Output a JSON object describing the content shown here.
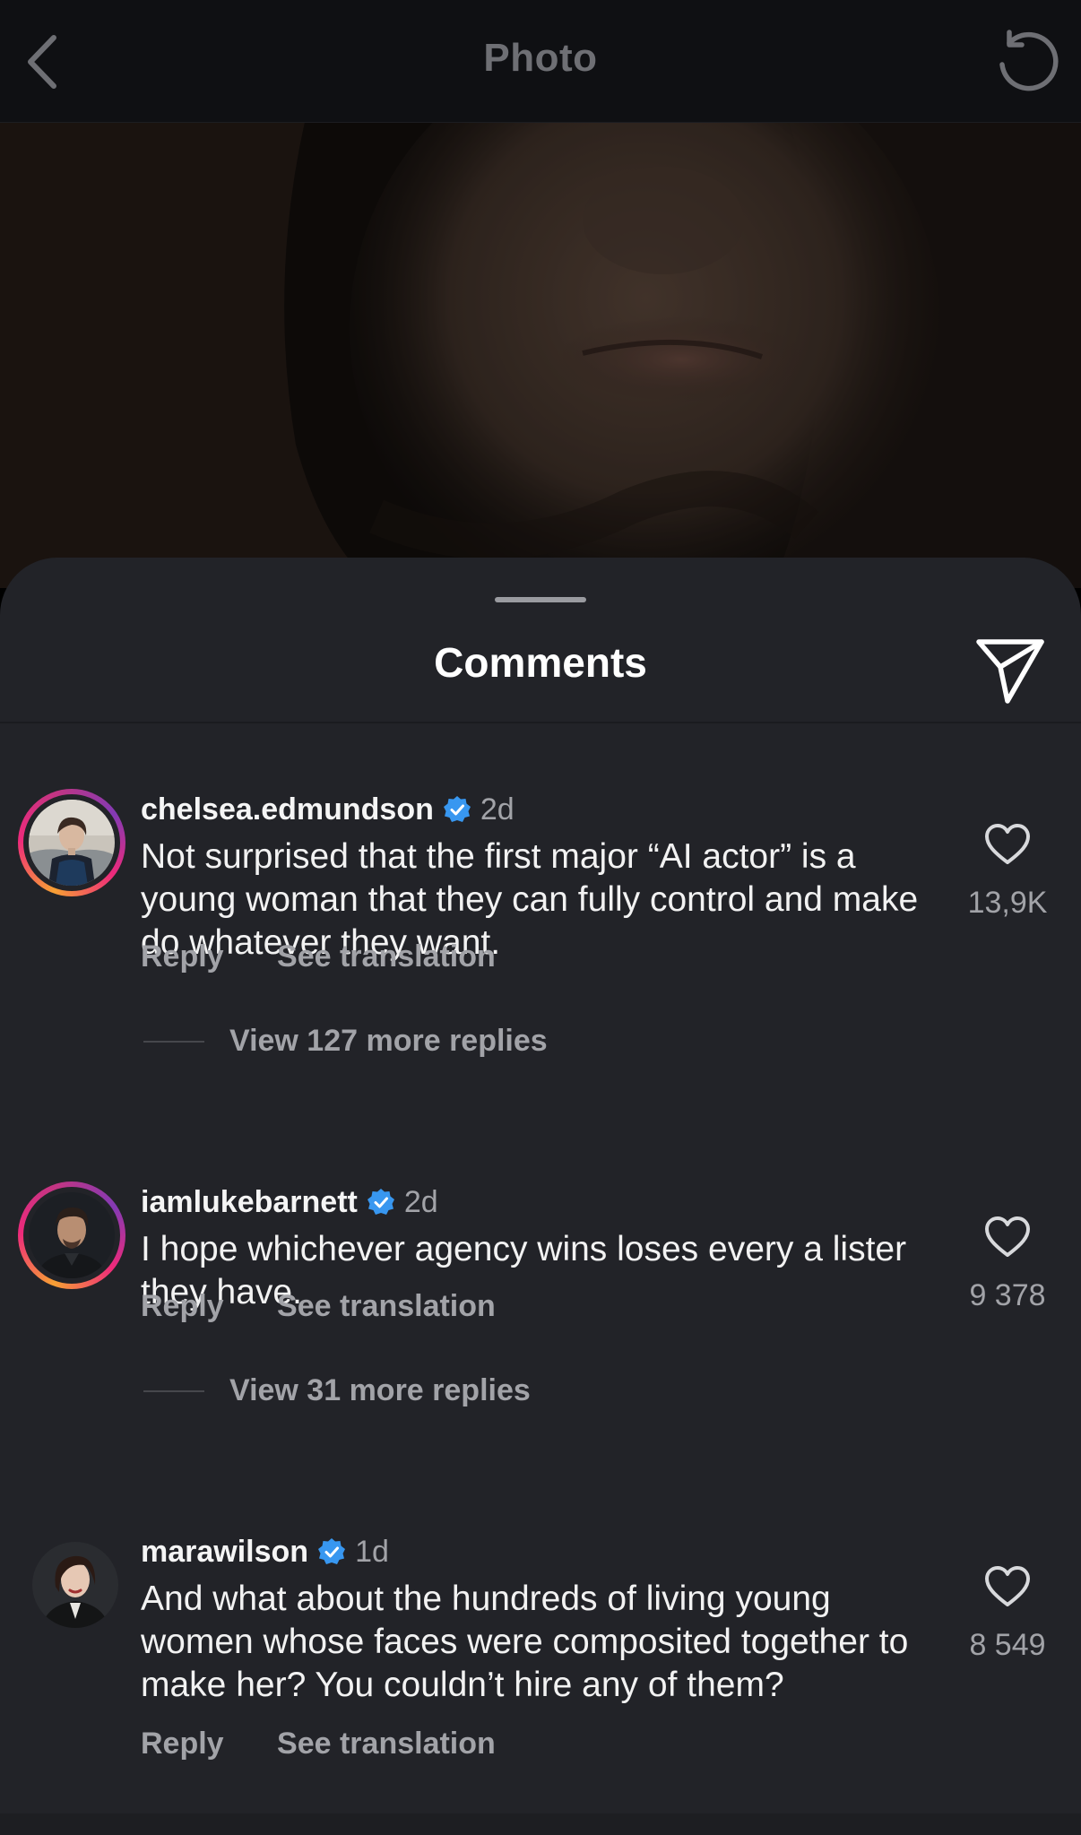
{
  "topbar": {
    "title": "Photo",
    "back_icon": "chevron-left-icon",
    "refresh_icon": "refresh-icon"
  },
  "sheet": {
    "title": "Comments",
    "share_icon": "paper-plane-icon"
  },
  "comments": [
    {
      "username": "chelsea.edmundson",
      "verified": true,
      "time": "2d",
      "text": "Not surprised that the first major “AI actor” is a young woman that they can fully control and make do whatever they want.",
      "reply_label": "Reply",
      "translate_label": "See translation",
      "likes": "13,9K",
      "view_replies": "View 127 more replies"
    },
    {
      "username": "iamlukebarnett",
      "verified": true,
      "time": "2d",
      "text": "I hope whichever agency wins loses every a lister they have.",
      "reply_label": "Reply",
      "translate_label": "See translation",
      "likes": "9 378",
      "view_replies": "View 31 more replies"
    },
    {
      "username": "marawilson",
      "verified": true,
      "time": "1d",
      "text": "And what about the hundreds of living young women whose faces were composited together to make her? You couldn’t hire any of them?",
      "reply_label": "Reply",
      "translate_label": "See translation",
      "likes": "8 549"
    }
  ],
  "colors": {
    "sheet_bg": "#222328",
    "topbar_bg": "#0f1013",
    "secondary_text": "#a2a3a8",
    "verified_blue": "#3897f0"
  }
}
